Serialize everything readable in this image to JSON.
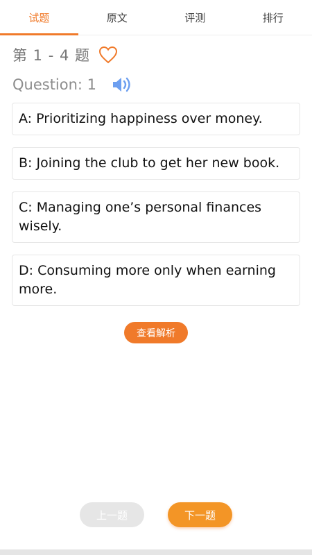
{
  "tabs": [
    {
      "label": "试题",
      "active": true
    },
    {
      "label": "原文",
      "active": false
    },
    {
      "label": "评测",
      "active": false
    },
    {
      "label": "排行",
      "active": false
    }
  ],
  "header": {
    "range_title": "第 1 - 4 题",
    "question_label": "Question: 1"
  },
  "icons": {
    "favorite": "heart-outline-icon",
    "audio": "speaker-icon"
  },
  "options": [
    {
      "text": "A: Prioritizing happiness over money."
    },
    {
      "text": "B: Joining the club to get her new book."
    },
    {
      "text": "C: Managing one’s personal finances wisely."
    },
    {
      "text": "D: Consuming more only when earning more."
    }
  ],
  "buttons": {
    "analysis": "查看解析",
    "prev": "上一题",
    "next": "下一题"
  },
  "colors": {
    "accent": "#f07a2a",
    "speaker": "#6d9ff0",
    "disabled": "#e6e6e6"
  }
}
